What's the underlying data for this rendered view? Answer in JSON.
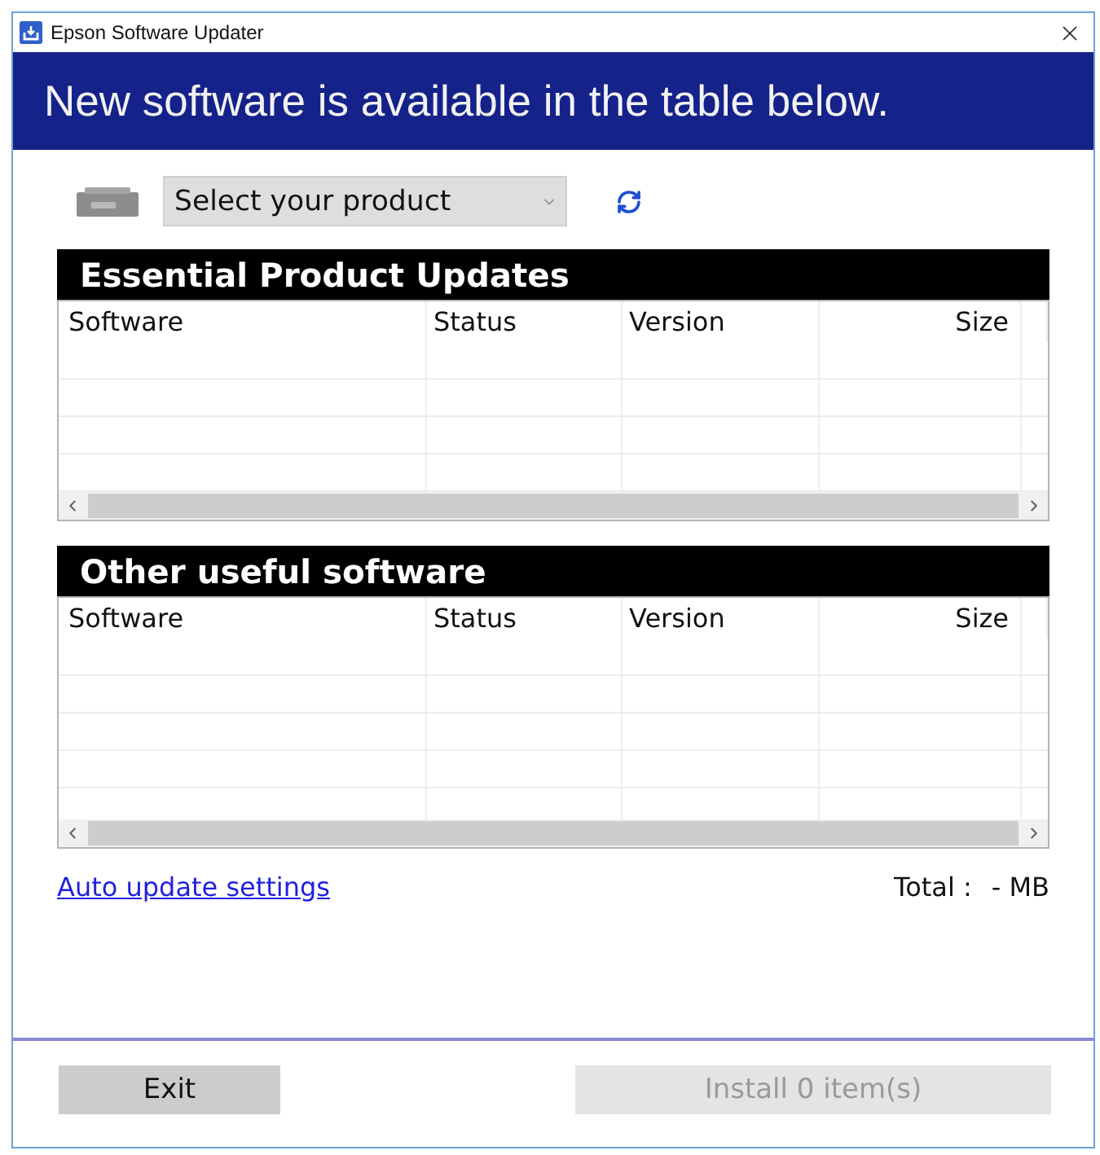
{
  "window": {
    "title": "Epson Software Updater"
  },
  "banner": {
    "text": "New software is available in the table below."
  },
  "product_selector": {
    "value": "Select your product"
  },
  "sections": [
    {
      "title": "Essential Product Updates",
      "columns": [
        "Software",
        "Status",
        "Version",
        "Size"
      ]
    },
    {
      "title": "Other useful software",
      "columns": [
        "Software",
        "Status",
        "Version",
        "Size"
      ]
    }
  ],
  "footer": {
    "link": "Auto update settings",
    "total_label": "Total :",
    "total_value": "- MB"
  },
  "buttons": [
    {
      "label": "Exit",
      "disabled": false
    },
    {
      "label": "Install 0 item(s)",
      "disabled": true
    }
  ]
}
